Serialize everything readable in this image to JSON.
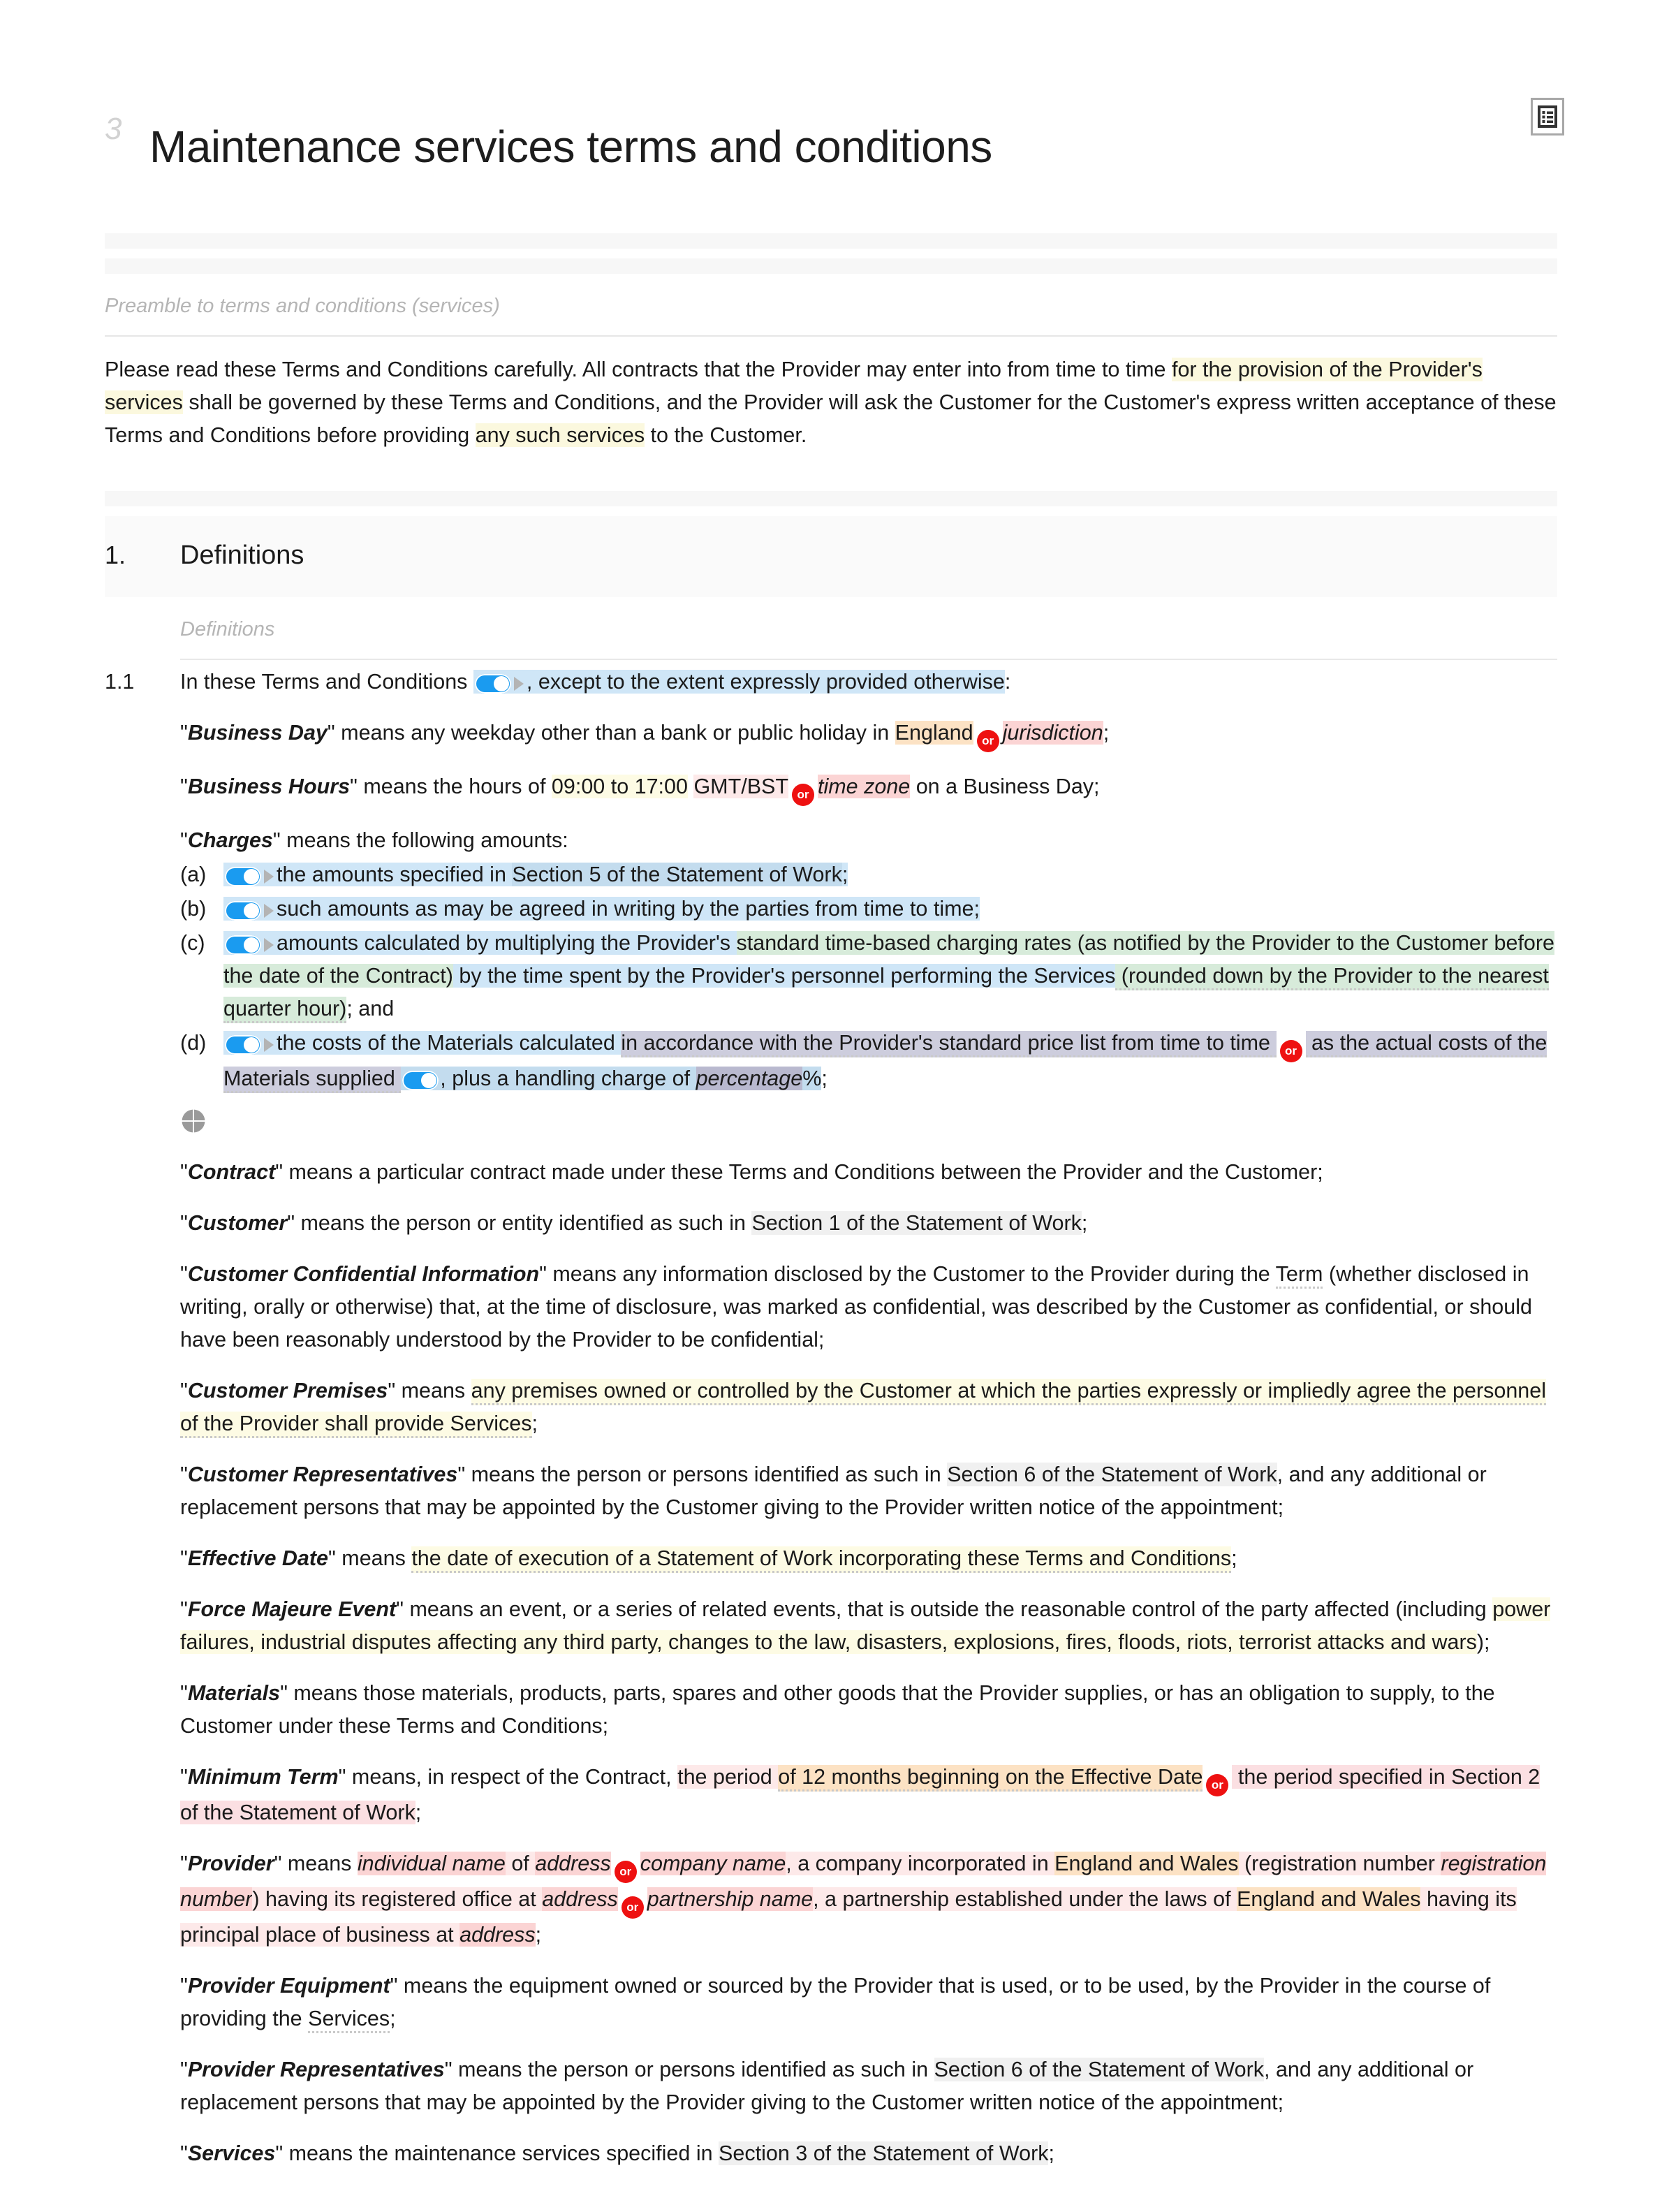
{
  "header": {
    "edit_glyph": "3",
    "title": "Maintenance services terms and conditions",
    "icon": "document-list-icon"
  },
  "preamble": {
    "label": "Preamble to terms and conditions (services)",
    "t1": "Please read these Terms and Conditions carefully. All contracts that the Provider may enter into from time to time ",
    "h1": "for the provision of the Provider's services",
    "t2": " shall be governed by these Terms and Conditions, and the Provider will ask the Customer for the Customer's express written acceptance of these Terms and Conditions before providing ",
    "h2": "any such services",
    "t3": " to the Customer."
  },
  "section1": {
    "number": "1.",
    "title": "Definitions",
    "label": "Definitions"
  },
  "clause11": {
    "number": "1.1",
    "t1": "In these Terms and Conditions ",
    "t2": ", except to the extent expressly provided otherwise",
    "t3": ":"
  },
  "defs": {
    "business_day": {
      "term": "Business Day",
      "t1": "\" means any weekday other than a bank or public holiday in ",
      "england": "England",
      "or": "or",
      "jurisdiction": "jurisdiction",
      "t2": ";"
    },
    "business_hours": {
      "term": "Business Hours",
      "t1": "\" means the hours of ",
      "hours": "09:00 to 17:00",
      "tz": "GMT/BST",
      "or": "or",
      "timezone": "time zone",
      "t2": " on a Business Day;"
    },
    "charges": {
      "term": "Charges",
      "t1": "\" means the following amounts:",
      "items": [
        {
          "marker": "(a)",
          "a": "the amounts specified in ",
          "b": "Section 5 of the Statement of Work",
          "c": ";"
        },
        {
          "marker": "(b)",
          "a": "such amounts as may be agreed in writing by the parties from time to time;"
        },
        {
          "marker": "(c)",
          "a": "amounts calculated by multiplying the Provider's ",
          "b": "standard time-based charging rates (as notified by the Provider to the Customer before the date of the Contract)",
          "c": " by the time spent by the Provider's personnel performing the Services",
          "d": " (rounded down by the Provider to the nearest quarter hour)",
          "e": "; and"
        },
        {
          "marker": "(d)",
          "a": "the costs of the Materials calculated ",
          "b": "in accordance with the Provider's standard price list from time to time ",
          "or": "or",
          "c": " as the actual costs of the Materials supplied ",
          "d": ", plus a handling charge of ",
          "e": "percentage",
          "f": "%",
          "g": ";"
        }
      ]
    },
    "contract": {
      "term": "Contract",
      "t1": "\" means a particular contract made under these Terms and Conditions between the Provider and the Customer;"
    },
    "customer": {
      "term": "Customer",
      "t1": "\" means the person or entity identified as such in ",
      "h": "Section 1 of the Statement of Work",
      "t2": ";"
    },
    "customer_confidential": {
      "term": "Customer Confidential Information",
      "t1": "\" means any information disclosed by the Customer to the Provider during the ",
      "h": "Term",
      "t2": " (whether disclosed in writing, orally or otherwise) that, at the time of disclosure, was marked as confidential, was described by the Customer as confidential, or should have been reasonably understood by the Provider to be confidential;"
    },
    "customer_premises": {
      "term": "Customer Premises",
      "t1": "\" means ",
      "h": "any premises owned or controlled by the Customer at which the parties expressly or impliedly agree the personnel of the Provider shall provide Services",
      "t2": ";"
    },
    "customer_representatives": {
      "term": "Customer Representatives",
      "t1": "\" means the person or persons identified as such in ",
      "h": "Section 6 of the Statement of Work",
      "t2": ", and any additional or replacement persons that may be appointed by the Customer giving to the Provider written notice of the appointment;"
    },
    "effective_date": {
      "term": "Effective Date",
      "t1": "\" means ",
      "h": "the date of execution of a Statement of Work incorporating these Terms and Conditions",
      "t2": ";"
    },
    "force_majeure": {
      "term": "Force Majeure Event",
      "t1": "\" means an event, or a series of related events, that is outside the reasonable control of the party affected (including ",
      "h": "power failures, industrial disputes affecting any third party, changes to the law, disasters, explosions, fires, floods, riots, terrorist attacks and wars",
      "t2": ");"
    },
    "materials": {
      "term": "Materials",
      "t1": "\" means those materials, products, parts, spares and other goods that the Provider supplies, or has an obligation to supply, to the Customer under these Terms and Conditions;"
    },
    "minimum_term": {
      "term": "Minimum Term",
      "t1": "\" means, in respect of the Contract, ",
      "h1": "the period ",
      "h2": "of 12 months beginning on the Effective Date",
      "or": "or",
      "h3": " the period specified in Section 2 of the Statement of Work",
      "t2": ";"
    },
    "provider": {
      "term": "Provider",
      "t1": "\" means ",
      "individual_name": "individual name",
      "of": " of ",
      "address1": "address",
      "or1": "or",
      "company_name": "company name",
      "t2": ", a company incorporated in ",
      "england_wales": "England and Wales",
      "t3": " (registration number ",
      "registration_number": "registration number",
      "t4": ") having its registered office at ",
      "address2": "address",
      "or2": "or",
      "partnership_name": "partnership name",
      "t5": ", a partnership established under the laws of ",
      "england_wales2": "England and Wales",
      "t6": " having its principal place of business at ",
      "address3": "address",
      "t7": ";"
    },
    "provider_equipment": {
      "term": "Provider Equipment",
      "t1": "\" means the equipment owned or sourced by the Provider that is used, or to be used, by the Provider in the course of providing the ",
      "h": "Services",
      "t2": ";"
    },
    "provider_representatives": {
      "term": "Provider Representatives",
      "t1": "\" means the person or persons identified as such in ",
      "h": "Section 6 of the Statement of Work",
      "t2": ", and any additional or replacement persons that may be appointed by the Provider giving to the Customer written notice of the appointment;"
    },
    "services": {
      "term": "Services",
      "t1": "\" means the maintenance services specified in ",
      "h": "Section 3 of the Statement of Work",
      "t2": ";"
    }
  },
  "icons": {
    "quad_circle": "quadrant-circle-icon"
  },
  "colors": {
    "toggle_on": "#1a9bf0",
    "or_badge": "#ee1111",
    "highlight_yellow": "#fbf8de",
    "highlight_peach": "#fce2c4",
    "highlight_pink": "#fbd4d4",
    "highlight_blue": "#cfe6f7",
    "highlight_green": "#d7ebda",
    "highlight_lavender": "#cdcddd",
    "highlight_gray": "#f0f0f0"
  }
}
